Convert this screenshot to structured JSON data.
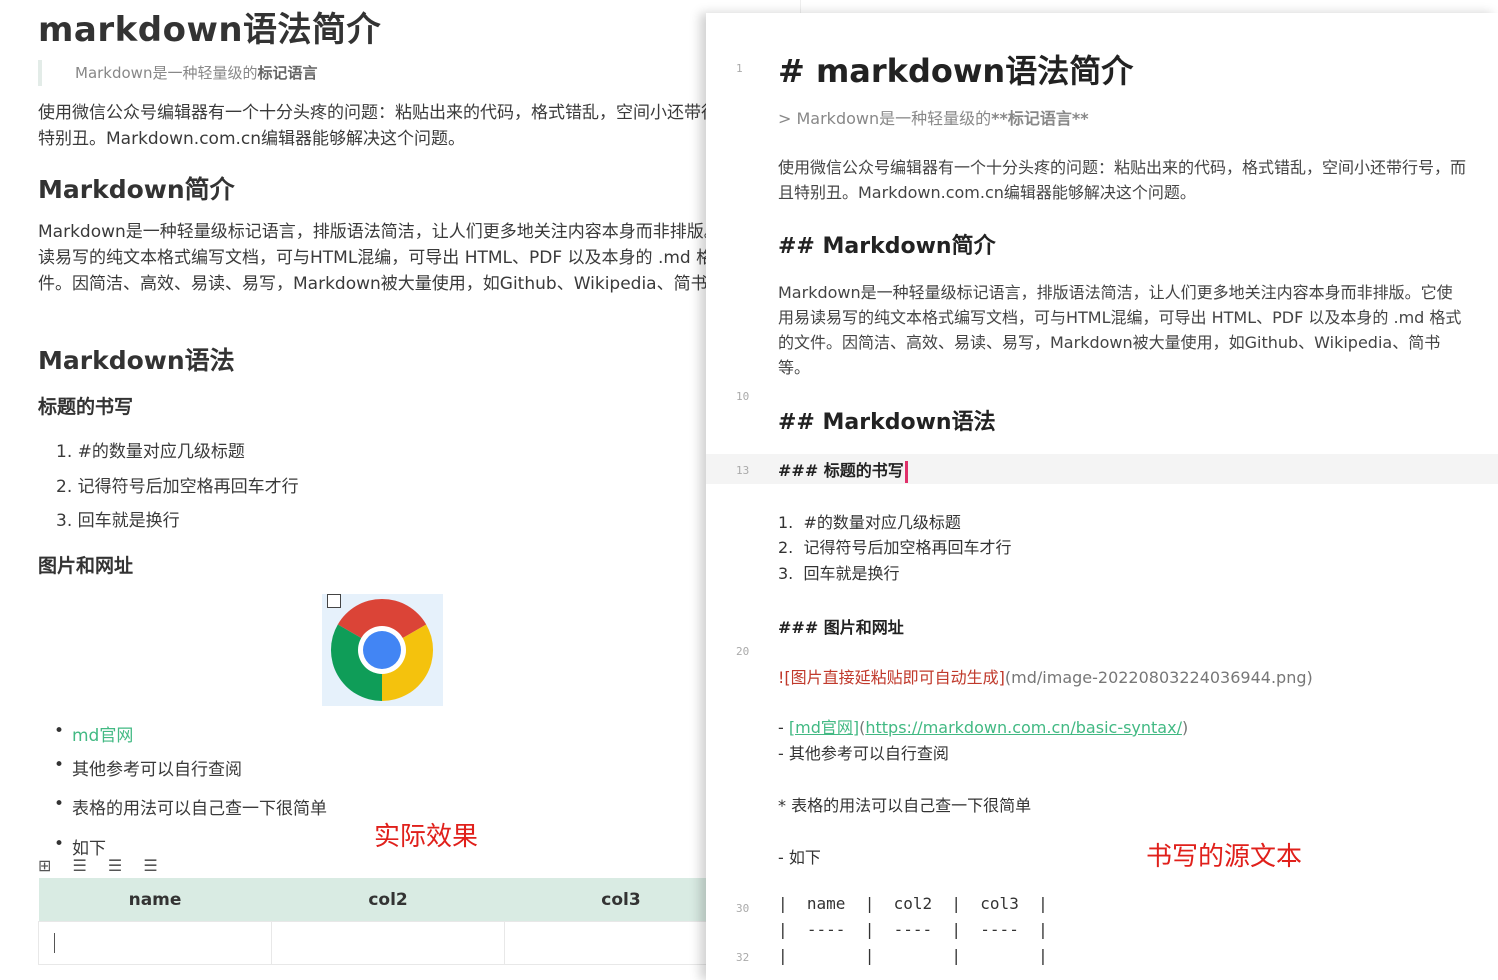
{
  "preview": {
    "title": "markdown语法简介",
    "quote_prefix": "Markdown是一种轻量级的",
    "quote_bold": "标记语言",
    "para1": "使用微信公众号编辑器有一个十分头疼的问题：粘贴出来的代码，格式错乱，空间小还带行号，而且特别丑。Markdown.com.cn编辑器能够解决这个问题。",
    "h2_intro": "Markdown简介",
    "para2": "Markdown是一种轻量级标记语言，排版语法简洁，让人们更多地关注内容本身而非排版。它使用易读易写的纯文本格式编写文档，可与HTML混编，可导出 HTML、PDF 以及本身的 .md 格式的文件。因简洁、高效、易读、易写，Markdown被大量使用，如Github、Wikipedia、简书等。",
    "h2_syntax": "Markdown语法",
    "h3_heading": "标题的书写",
    "ol": [
      "#的数量对应几级标题",
      "记得符号后加空格再回车才行",
      "回车就是换行"
    ],
    "h3_image": "图片和网址",
    "ul": [
      "md官网",
      "其他参考可以自行查阅",
      "表格的用法可以自己查一下很简单",
      "如下"
    ],
    "table_headers": [
      "name",
      "col2",
      "col3"
    ],
    "toolbar_icons": "⊞ ☰ ☰ ☰",
    "label": "实际效果"
  },
  "editor": {
    "line_numbers": [
      "1",
      "10",
      "13",
      "20",
      "30",
      "32"
    ],
    "h1": "# markdown语法简介",
    "quote_prefix": ">  Markdown是一种轻量级的",
    "quote_bold": "**标记语言**",
    "para1": "使用微信公众号编辑器有一个十分头疼的问题：粘贴出来的代码，格式错乱，空间小还带行号，而且特别丑。Markdown.com.cn编辑器能够解决这个问题。",
    "h2_intro": "## Markdown简介",
    "para2": "Markdown是一种轻量级标记语言，排版语法简洁，让人们更多地关注内容本身而非排版。它使用易读易写的纯文本格式编写文档，可与HTML混编，可导出 HTML、PDF 以及本身的 .md 格式的文件。因简洁、高效、易读、易写，Markdown被大量使用，如Github、Wikipedia、简书等。",
    "h2_syntax": "## Markdown语法",
    "h3_heading": "### 标题的书写",
    "ol": [
      "1.  #的数量对应几级标题",
      "2.  记得符号后加空格再回车才行",
      "3.  回车就是换行"
    ],
    "h3_image": "### 图片和网址",
    "img_alt": "![图片直接延粘贴即可自动生成]",
    "img_path": "(md/image-20220803224036944.png)",
    "link_dash": "-  ",
    "link_text": "[md官网]",
    "link_url": "https://markdown.com.cn/basic-syntax/",
    "other_ref": "-  其他参考可以自行查阅",
    "table_note": "*  表格的用法可以自己查一下很简单",
    "as_below": "-  如下",
    "table_row1": "|  name  |  col2  |  col3  |",
    "table_row2": "|  ----  |  ----  |  ----  |",
    "table_row3": "|        |        |        |",
    "label": "书写的源文本"
  }
}
